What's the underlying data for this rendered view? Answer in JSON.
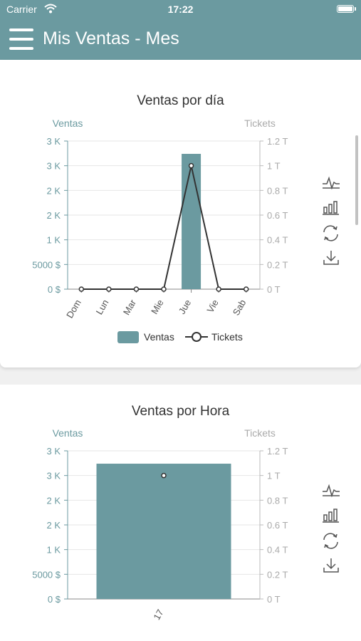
{
  "status_bar": {
    "carrier": "Carrier",
    "time": "17:22"
  },
  "header": {
    "title": "Mis Ventas - Mes"
  },
  "colors": {
    "primary": "#6b9aa0",
    "line": "#333333",
    "axis_left": "#6b9aa0",
    "axis_right": "#aaaaaa"
  },
  "toolbox": [
    "line-chart-icon",
    "bar-chart-icon",
    "refresh-icon",
    "download-icon"
  ],
  "chart_data": [
    {
      "type": "bar",
      "title": "Ventas por día",
      "ylabel": "Ventas",
      "ylabel_right": "Tickets",
      "categories": [
        "Dom",
        "Lun",
        "Mar",
        "Mie",
        "Jue",
        "Vie",
        "Sab"
      ],
      "y_ticks": [
        "0 $",
        "5000 $",
        "1 K",
        "2 K",
        "2 K",
        "3 K",
        "3 K"
      ],
      "y_right_ticks": [
        "0 T",
        "0.2 T",
        "0.4 T",
        "0.6 T",
        "0.8 T",
        "1 T",
        "1.2 T"
      ],
      "ylim": [
        0,
        30000
      ],
      "ylim_right": [
        0,
        1.2
      ],
      "series": [
        {
          "name": "Ventas",
          "type": "bar",
          "values": [
            0,
            0,
            0,
            0,
            27400,
            0,
            0
          ]
        },
        {
          "name": "Tickets",
          "type": "line",
          "values": [
            0,
            0,
            0,
            0,
            1,
            0,
            0
          ]
        }
      ],
      "legend": "bottom"
    },
    {
      "type": "bar",
      "title": "Ventas por Hora",
      "ylabel": "Ventas",
      "ylabel_right": "Tickets",
      "categories": [
        "17"
      ],
      "y_ticks": [
        "0 $",
        "5000 $",
        "1 K",
        "2 K",
        "2 K",
        "3 K",
        "3 K"
      ],
      "y_right_ticks": [
        "0 T",
        "0.2 T",
        "0.4 T",
        "0.6 T",
        "0.8 T",
        "1 T",
        "1.2 T"
      ],
      "ylim": [
        0,
        30000
      ],
      "ylim_right": [
        0,
        1.2
      ],
      "series": [
        {
          "name": "Ventas",
          "type": "bar",
          "values": [
            27400
          ]
        },
        {
          "name": "Tickets",
          "type": "line",
          "values": [
            1
          ]
        }
      ]
    }
  ]
}
